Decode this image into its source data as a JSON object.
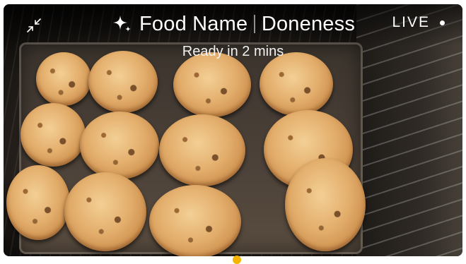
{
  "header": {
    "food_name": "Food Name",
    "doneness": "Doneness",
    "status_text": "Ready in 2 mins",
    "live_label": "LIVE"
  },
  "icons": {
    "collapse": "collapse-arrows-icon",
    "sparkle": "sparkle-icon",
    "live_indicator": "live-dot-icon"
  },
  "colors": {
    "overlay_text": "#ffffff",
    "accent": "#f4b400"
  },
  "camera": {
    "subject": "cookies on oven tray"
  }
}
